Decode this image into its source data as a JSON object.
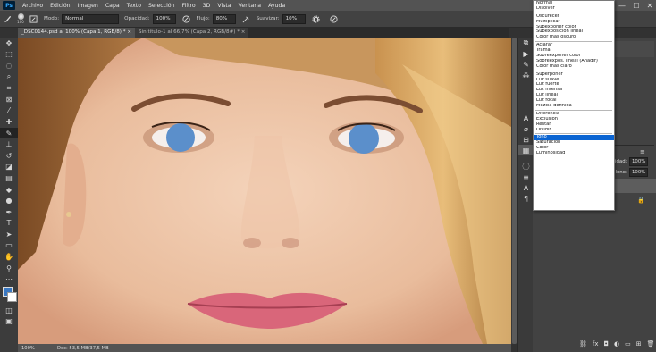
{
  "menu": {
    "logo": "Ps",
    "items": [
      "Archivo",
      "Edición",
      "Imagen",
      "Capa",
      "Texto",
      "Selección",
      "Filtro",
      "3D",
      "Vista",
      "Ventana",
      "Ayuda"
    ]
  },
  "window_controls": {
    "minimize": "—",
    "maximize": "☐",
    "close": "✕"
  },
  "options_bar": {
    "brush_size": "100",
    "mode_label": "Modo:",
    "mode_value": "Normal",
    "opacity_label": "Opacidad:",
    "opacity_value": "100%",
    "flow_label": "Flujo:",
    "flow_value": "80%",
    "smoothing_label": "Suavizar:",
    "smoothing_value": "10%"
  },
  "tabs": [
    {
      "label": "_DSC0144.psd al 100% (Capa 1, RGB/8) * ×"
    },
    {
      "label": "Sin título-1 al 66,7% (Capa 2, RGB/8#) * ×"
    }
  ],
  "status": {
    "zoom": "100%",
    "doc": "Doc: 53,5 MB/37,5 MB"
  },
  "blend_menu": {
    "groups": [
      [
        "Normal",
        "Disolver"
      ],
      [
        "Oscurecer",
        "Multiplicar",
        "Subexponer color",
        "Subexposición lineal",
        "Color más oscuro"
      ],
      [
        "Aclarar",
        "Trama",
        "Sobreexponer color",
        "Sobreexpos. lineal (Añadir)",
        "Color más claro"
      ],
      [
        "Superponer",
        "Luz suave",
        "Luz fuerte",
        "Luz intensa",
        "Luz lineal",
        "Luz focal",
        "Mezcla definida"
      ],
      [
        "Diferencia",
        "Exclusión",
        "Restar",
        "Dividir"
      ],
      [
        "Tono",
        "Saturación",
        "Color",
        "Luminosidad"
      ]
    ],
    "selected": "Tono"
  },
  "layers_panel": {
    "opacity_label": "idad:",
    "opacity_value": "100%",
    "fill_label": "lleno:",
    "fill_value": "100%"
  },
  "colors": {
    "accent": "#0a64d2",
    "eye_paint": "#5b8fcb"
  }
}
